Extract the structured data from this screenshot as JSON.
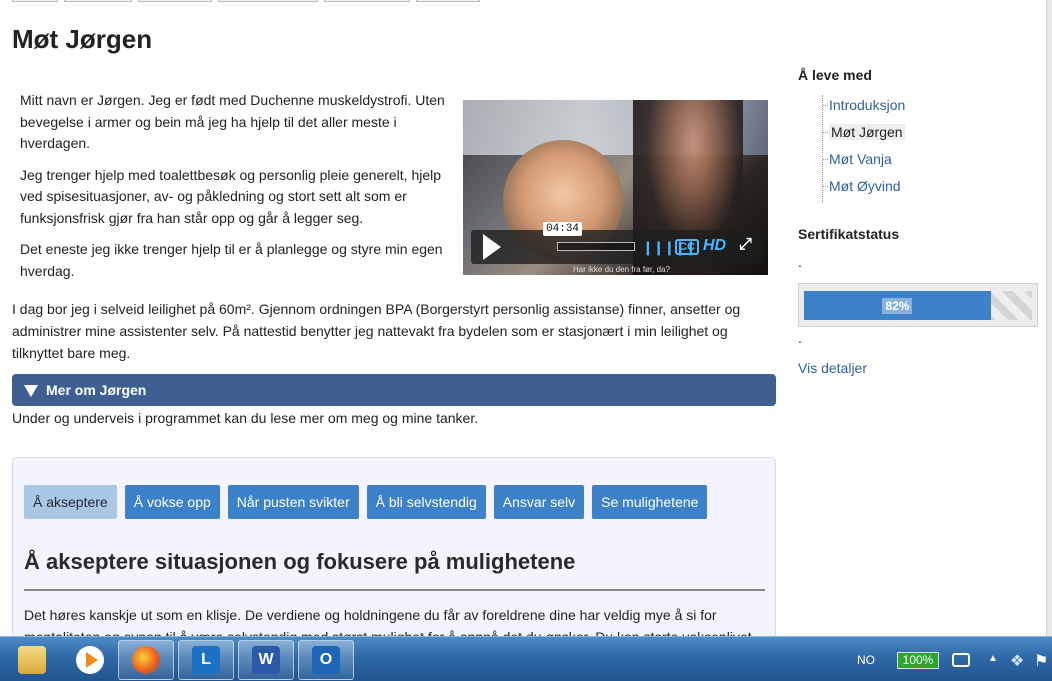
{
  "page": {
    "title": "Møt Jørgen"
  },
  "intro": {
    "p1": "Mitt navn er Jørgen. Jeg er født med Duchenne muskeldystrofi. Uten bevegelse i armer og bein må jeg ha hjelp til det aller meste i hverdagen.",
    "p2": "Jeg trenger hjelp med toalettbesøk og personlig pleie generelt, hjelp ved spisesituasjoner, av- og påkledning og stort sett alt som er funksjonsfrisk gjør fra han står opp og går å legger seg.",
    "p3": "Det eneste jeg ikke trenger hjelp til er å planlegge og styre min egen hverdag."
  },
  "video": {
    "time": "04:34",
    "volume_icon": "volume-bars-icon",
    "cc_label": "CC",
    "hd_label": "HD",
    "subtitle": "Har ikke du den fra før, da?"
  },
  "body": {
    "paragraph": "I dag bor jeg i selveid leilighet på 60m². Gjennom ordningen BPA (Borgerstyrt personlig assistanse) finner, ansetter og administrer mine assistenter selv. På nattestid benytter jeg nattevakt fra bydelen som er stasjonært i min leilighet og tilknyttet bare meg."
  },
  "accordion": {
    "title": "Mer om Jørgen",
    "note": "Under og underveis i programmet kan du lese mer om meg og mine tanker."
  },
  "panel": {
    "tabs": [
      {
        "label": "Å akseptere",
        "active": true
      },
      {
        "label": "Å vokse opp",
        "active": false
      },
      {
        "label": "Når pusten svikter",
        "active": false
      },
      {
        "label": "Å bli selvstendig",
        "active": false
      },
      {
        "label": "Ansvar selv",
        "active": false
      },
      {
        "label": "Se mulighetene",
        "active": false
      }
    ],
    "heading": "Å akseptere situasjonen og fokusere på mulighetene",
    "text": "Det høres kanskje ut som en klisje. De verdiene og holdningene du får av foreldrene dine har veldig mye å si for mentaliteten og evnen til å være selvstendig med størst mulighet for å oppnå det du ønsker. Du kan starte voksenlivet"
  },
  "sidebar": {
    "section_title": "Å leve med",
    "nav": [
      {
        "label": "Introduksjon",
        "current": false
      },
      {
        "label": "Møt Jørgen",
        "current": true
      },
      {
        "label": "Møt Vanja",
        "current": false
      },
      {
        "label": "Møt Øyvind",
        "current": false
      }
    ],
    "cert_title": "Sertifikatstatus",
    "dot": ".",
    "progress_label": "82%",
    "progress_value": 0.82,
    "details_link": "Vis detaljer"
  },
  "taskbar": {
    "apps": [
      {
        "name": "explorer-icon",
        "label": ""
      },
      {
        "name": "media-player-icon",
        "label": ""
      },
      {
        "name": "firefox-icon",
        "label": ""
      },
      {
        "name": "lync-icon",
        "label": "L"
      },
      {
        "name": "word-icon",
        "label": "W"
      },
      {
        "name": "outlook-icon",
        "label": "O"
      }
    ],
    "language": "NO",
    "battery": "100%"
  },
  "colors": {
    "accordion": "#3f5f91",
    "tab": "#3d82c8",
    "tab_active": "#a9c6e2",
    "link": "#2f5f9f",
    "taskbar": "#2f69a8"
  }
}
